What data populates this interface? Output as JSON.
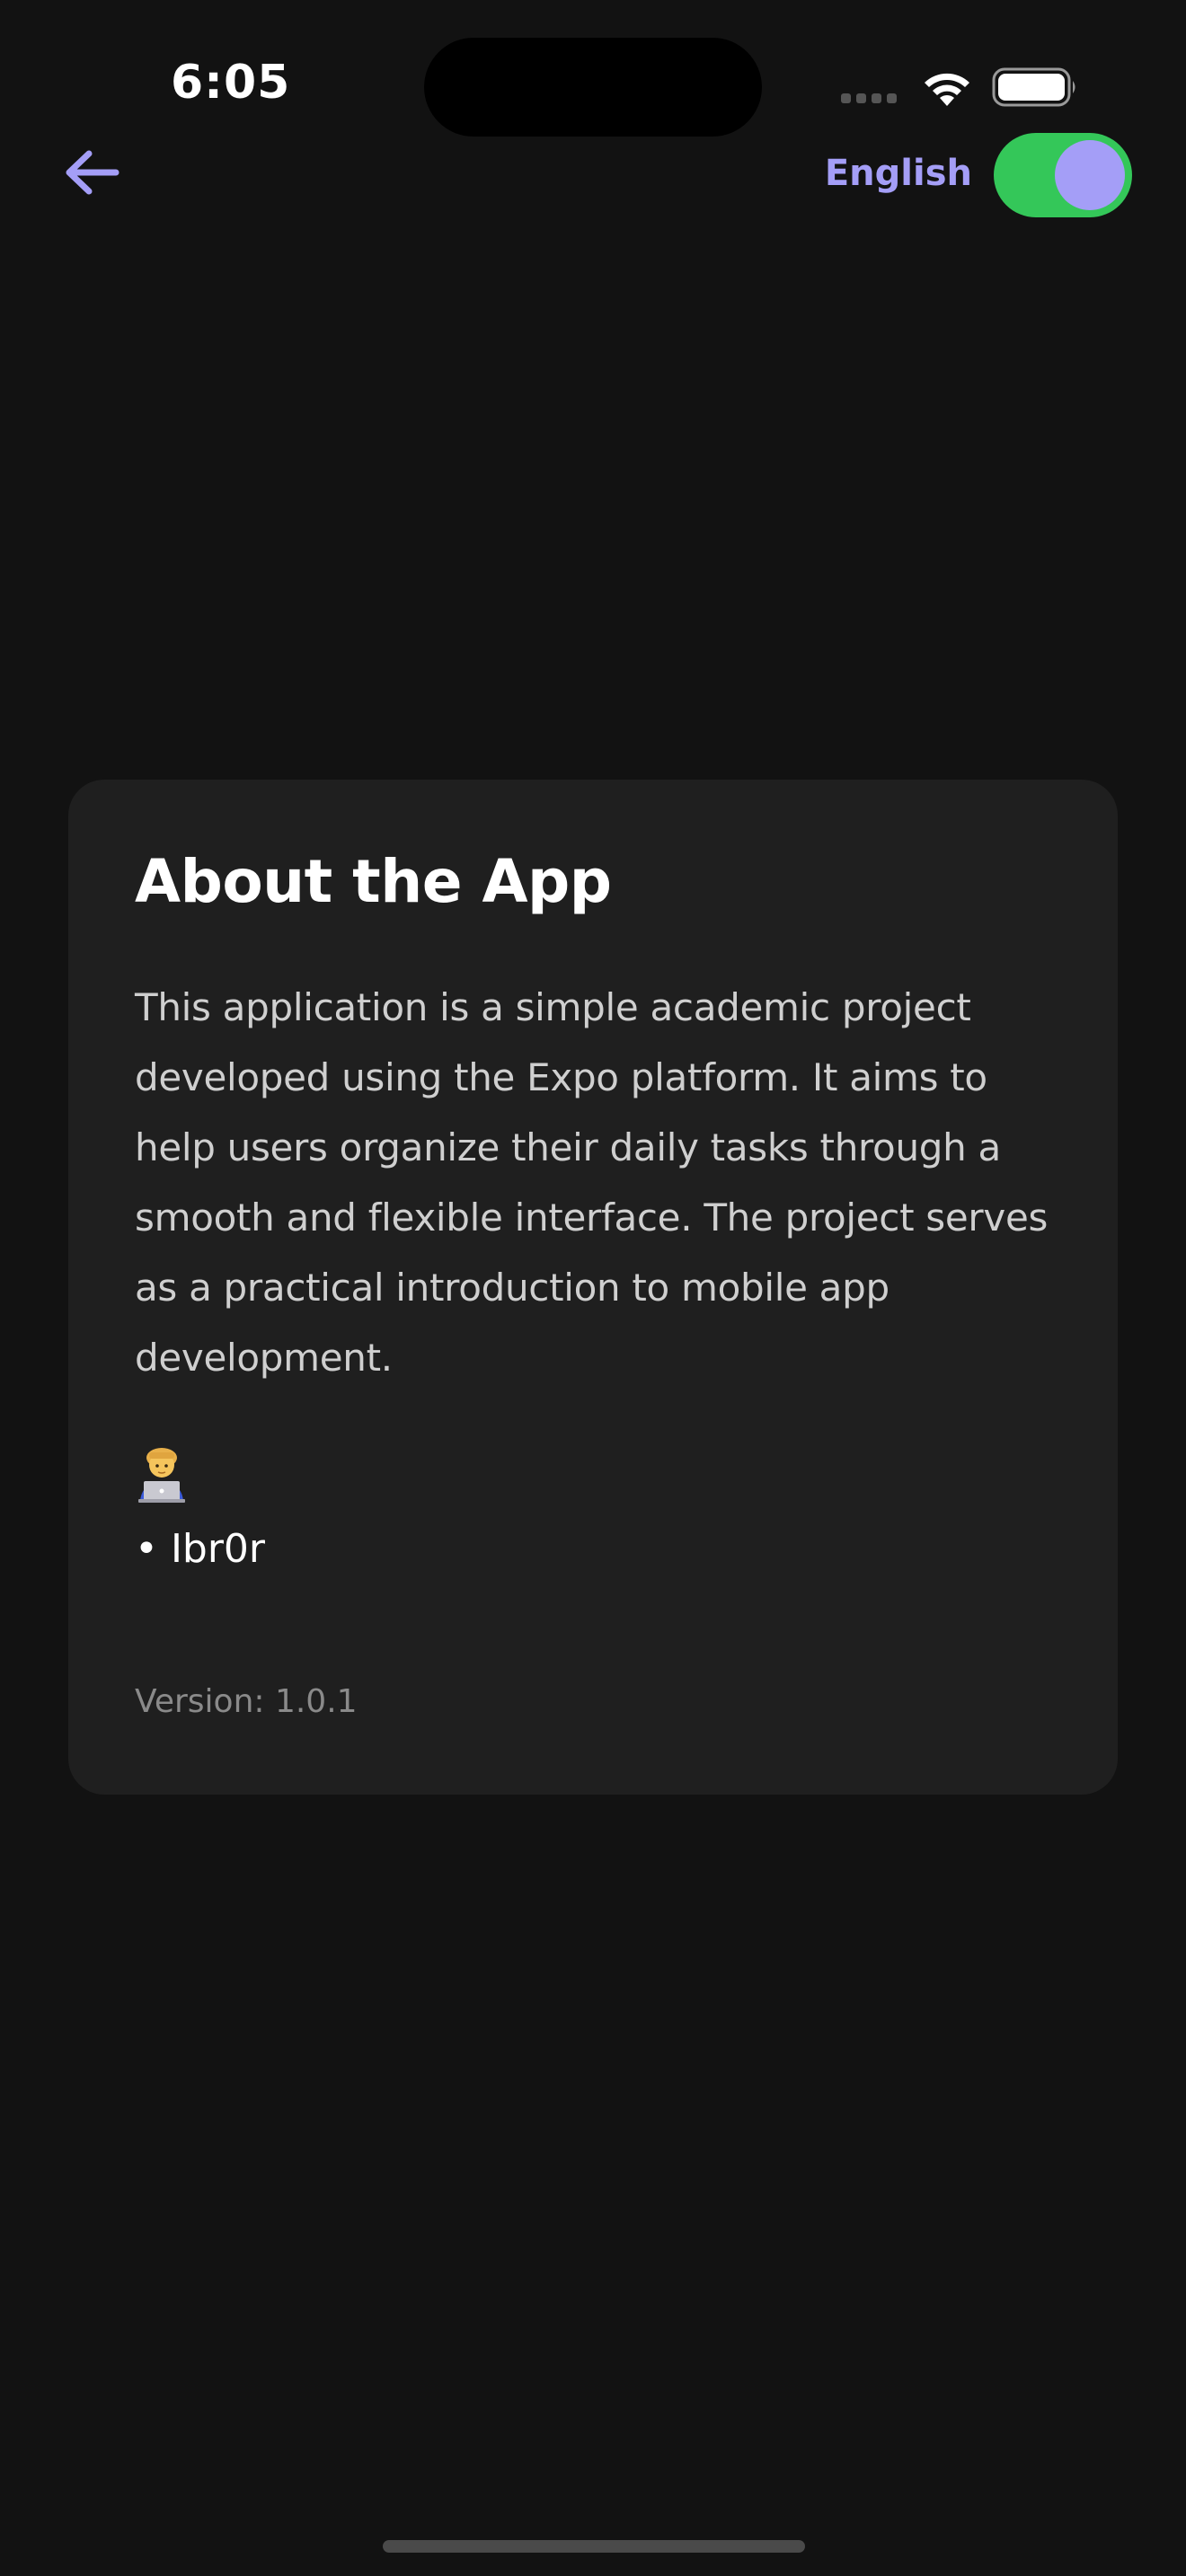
{
  "status_bar": {
    "time": "6:05",
    "icons": [
      "signal-icon",
      "wifi-icon",
      "battery-icon"
    ]
  },
  "header": {
    "back_icon": "arrow-left-icon",
    "language_label": "English",
    "language_toggle_on": true
  },
  "about": {
    "title": "About the App",
    "description": "This application is a simple academic project developed using the Expo platform. It aims to help users organize their daily tasks through a smooth and flexible interface. The project serves as a practical introduction to mobile app development.",
    "developer_icon": "technologist-emoji-icon",
    "developer_name": "• Ibr0r",
    "version": "Version: 1.0.1"
  },
  "colors": {
    "background": "#121212",
    "card": "#1f1f1f",
    "accent": "#a49ef7",
    "toggle_on": "#34c759"
  }
}
